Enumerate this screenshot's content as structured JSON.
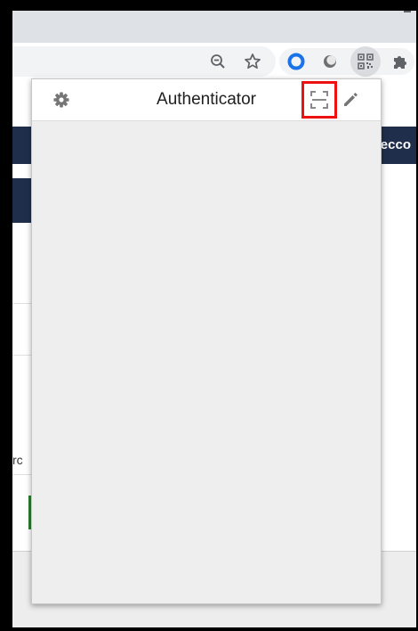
{
  "browser": {
    "toolbar": {
      "zoom_icon": "zoom-out-icon",
      "bookmark_icon": "star-icon",
      "extensions": [
        "password-manager-icon",
        "theme-icon",
        "authenticator-qr-icon",
        "puzzle-icon"
      ]
    }
  },
  "page": {
    "bar_text": "ecco",
    "fragment_text": "rc"
  },
  "popup": {
    "title": "Authenticator",
    "settings_icon": "gear-icon",
    "scan_icon": "scan-qr-icon",
    "edit_icon": "pencil-icon",
    "highlight_color": "#ee1111"
  },
  "colors": {
    "page_bar": "#1f2f4b",
    "accent_blue": "#1a73e8"
  }
}
